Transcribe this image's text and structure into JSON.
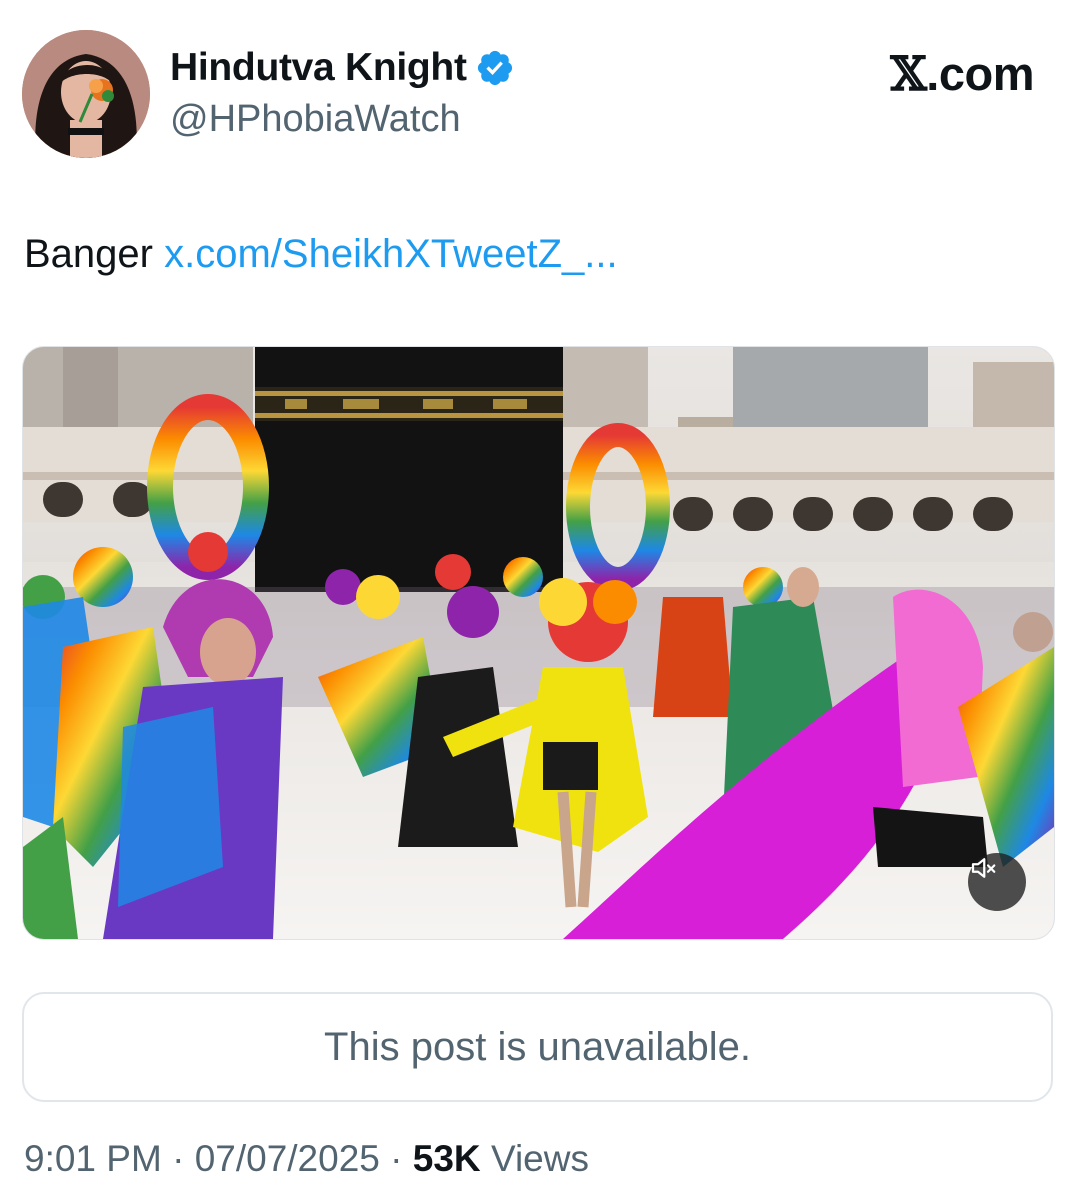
{
  "author": {
    "display_name": "Hindutva Knight",
    "handle": "@HPhobiaWatch",
    "verified": true,
    "verified_color": "#1d9bf0"
  },
  "brand": {
    "logo_mark": "𝕏",
    "logo_text": ".com"
  },
  "tweet": {
    "text": "Banger",
    "link_text": "x.com/SheikhXTweetZ_...",
    "link_color": "#1d9bf0"
  },
  "media": {
    "type": "video",
    "icons": [
      "mute-icon"
    ]
  },
  "quoted_post": {
    "text": "This post is unavailable."
  },
  "meta": {
    "time": "9:01 PM",
    "separator": "·",
    "date": "07/07/2025",
    "views_count": "53K",
    "views_label": "Views"
  }
}
